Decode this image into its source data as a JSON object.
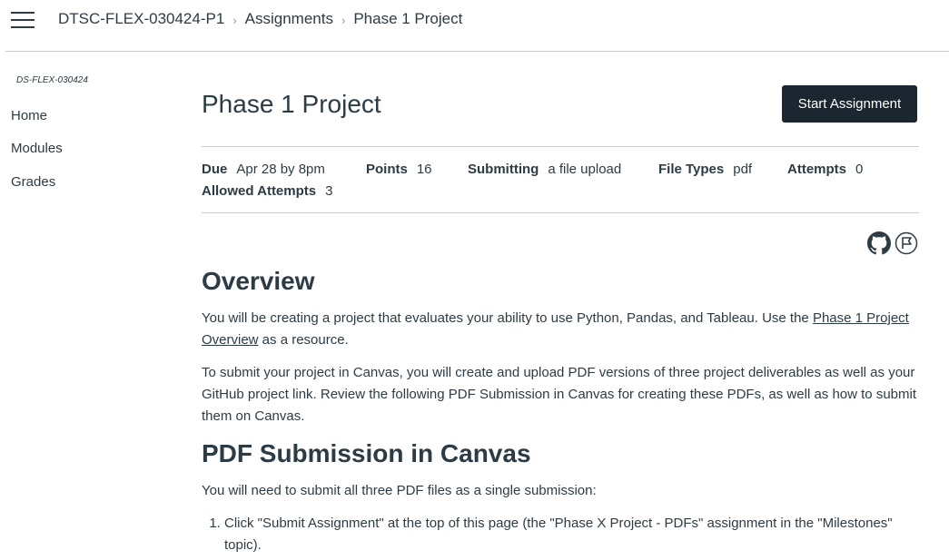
{
  "breadcrumb": {
    "course": "DTSC-FLEX-030424-P1",
    "section": "Assignments",
    "current": "Phase 1 Project"
  },
  "sidebar": {
    "course_code": "DS-FLEX-030424",
    "items": [
      {
        "label": "Home"
      },
      {
        "label": "Modules"
      },
      {
        "label": "Grades"
      }
    ]
  },
  "assignment": {
    "title": "Phase 1 Project",
    "start_button": "Start Assignment",
    "details": {
      "due_label": "Due",
      "due_value": "Apr 28 by 8pm",
      "points_label": "Points",
      "points_value": "16",
      "submitting_label": "Submitting",
      "submitting_value": "a file upload",
      "filetypes_label": "File Types",
      "filetypes_value": "pdf",
      "attempts_label": "Attempts",
      "attempts_value": "0",
      "allowed_label": "Allowed Attempts",
      "allowed_value": "3"
    }
  },
  "icons": {
    "github": "github-icon",
    "flag": "flag-icon"
  },
  "content": {
    "overview_heading": "Overview",
    "overview_p1_start": "You will be creating a project that evaluates your ability to use Python, Pandas, and Tableau. Use the ",
    "overview_p1_link": "Phase 1 Project Overview",
    "overview_p1_end": " as a resource.",
    "overview_p2": "To submit your project in Canvas, you will create and upload PDF versions of three project deliverables as well as your GitHub project link. Review the following PDF Submission in Canvas for creating these PDFs, as well as how to submit them on Canvas.",
    "pdf_heading": "PDF Submission in Canvas",
    "pdf_p1": "You will need to submit all three PDF files as a single submission:",
    "steps": [
      "Click \"Submit Assignment\" at the top of this page (the \"Phase X Project - PDFs\" assignment in the \"Milestones\" topic)."
    ]
  }
}
